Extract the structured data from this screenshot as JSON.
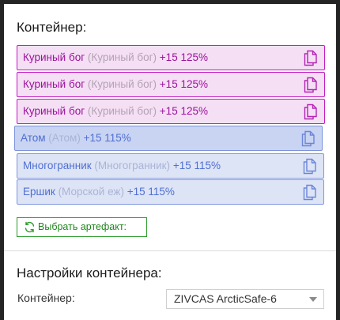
{
  "container": {
    "title": "Контейнер:",
    "items": [
      {
        "name": "Куриный бог",
        "alt": "(Куриный бог)",
        "bonus": "+15 125%",
        "style": "pink",
        "icon": "copy-icon"
      },
      {
        "name": "Куриный бог",
        "alt": "(Куриный бог)",
        "bonus": "+15 125%",
        "style": "pink",
        "icon": "copy-icon"
      },
      {
        "name": "Куриный бог",
        "alt": "(Куриный бог)",
        "bonus": "+15 125%",
        "style": "pink",
        "icon": "copy-icon"
      },
      {
        "name": "Атом",
        "alt": "(Атом)",
        "bonus": "+15 115%",
        "style": "blue",
        "icon": "copy-icon"
      },
      {
        "name": "Многогранник",
        "alt": "(Многогранник)",
        "bonus": "+15 115%",
        "style": "blue",
        "icon": "copy-icon"
      },
      {
        "name": "Ершик",
        "alt": "(Морской еж)",
        "bonus": "+15 115%",
        "style": "blue",
        "icon": "copy-icon"
      }
    ],
    "pick_button": {
      "label": "Выбрать артефакт:",
      "icon": "refresh-icon"
    }
  },
  "settings": {
    "title": "Настройки контейнера:",
    "container_label": "Контейнер:",
    "container_value": "ZIVCAS ArcticSafe-6"
  },
  "colors": {
    "rare_border": "#c21bc2",
    "rare_background": "#f5dff5",
    "common_border": "#7f98e0",
    "common_background": "#dde4f6",
    "button_green": "#2f9b2f",
    "page_background": "#242424"
  }
}
